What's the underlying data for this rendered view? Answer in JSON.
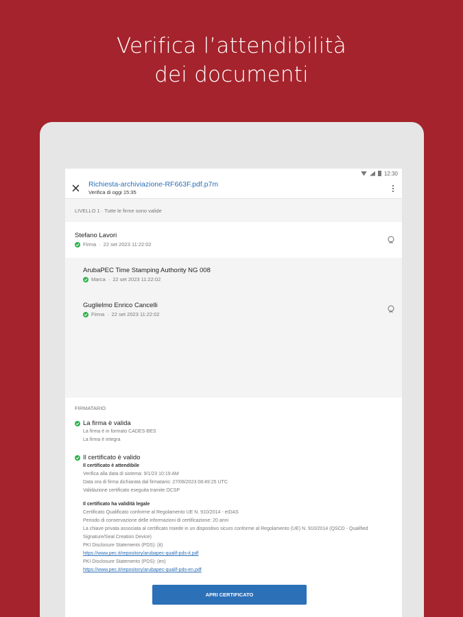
{
  "headline": {
    "line1": "Verifica l’attendibilità",
    "line2": "dei documenti"
  },
  "status_bar": {
    "time": "12:30"
  },
  "app_bar": {
    "file_name": "Richiesta-archiviazione-RF663F.pdf.p7m",
    "verification": "Verifica di oggi 15:35"
  },
  "level_label": "LIVELLO 1 · Tutte le firme sono valide",
  "signatures": [
    {
      "name": "Stefano Lavori",
      "type": "Firma",
      "date": "22 set 2023 11:22:02"
    },
    {
      "name": "ArubaPEC Time Stamping Authority NG 008",
      "type": "Marca",
      "date": "22 set 2023 11:22:02"
    },
    {
      "name": "Guglielmo Enrico Cancelli",
      "type": "Firma",
      "date": "22 set 2023 11:22:02"
    }
  ],
  "signer_section": {
    "title": "FIRMATARIO",
    "signature_status": {
      "heading": "La firma è valida",
      "lines": [
        "La firma è in formato CADES-BES",
        "La firma è integra"
      ]
    },
    "certificate_status": {
      "heading": "Il certificato è valido",
      "trust_title": "Il certificato è attendibile",
      "trust_lines": [
        "Verifica alla data di sistema: 9/1/23 10:19 AM",
        "Data ora di firma dichiarata dal firmatario: 27/08/2023 08:49:25 UTC",
        "Validazione certificato eseguita tramite OCSP"
      ],
      "legal_title": "Il certificato ha validità legale",
      "legal_lines": [
        "Certificato Qualificato conforme al Regolamento UE N. 910/2014 - eIDAS",
        "Periodo di conservazione delle informazioni di certificazione: 20 anni",
        "La chiave privata associata al certificato risiede in un dispositivo sicuro conforme al Regolamento (UE) N. 910/2014 (QSCD - Qualified Signature/Seal Creation Device)",
        "PKI Disclosure Statements (PDS): (it)"
      ],
      "link_it": "https://www.pec.it/repository/arubapec-qualif-pds-it.pdf",
      "pds_en_label": "PKI Disclosure Statements (PDS): (en)",
      "link_en": "https://www.pec.it/repository/arubapec-qualif-pds-en.pdf"
    }
  },
  "open_certificate_button": "APRI CERTIFICATO",
  "colors": {
    "background": "#a5232c",
    "accent": "#2c70b8",
    "valid": "#2bb24c"
  },
  "icons": [
    "close-icon",
    "more-vert-icon",
    "check-circle-icon",
    "seal-icon"
  ]
}
